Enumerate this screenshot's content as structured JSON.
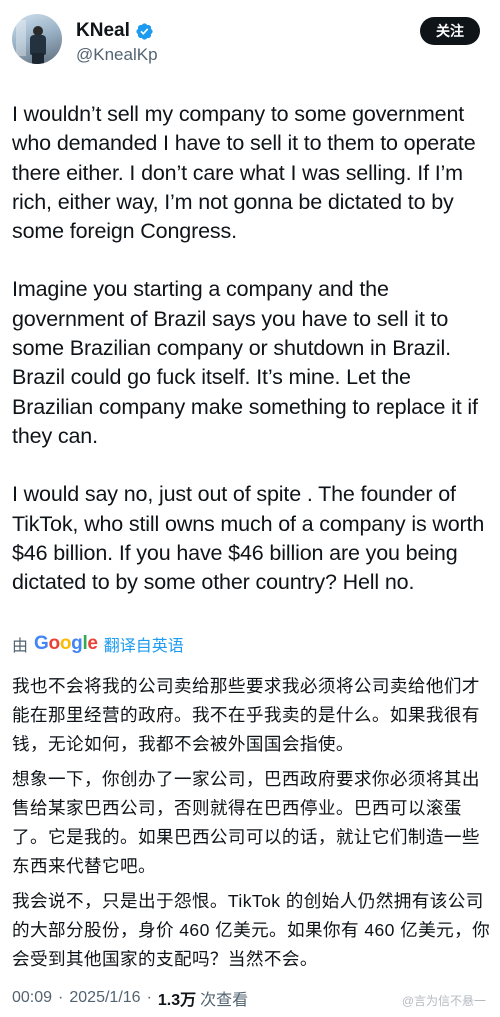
{
  "header": {
    "display_name": "KNeal",
    "handle": "@KnealKp",
    "follow_label": "关注"
  },
  "tweet": {
    "paragraphs": [
      "I wouldn’t sell my company to some government who demanded I have to sell it to them to operate there either. I don’t care what I was selling. If I’m rich, either way, I’m not gonna be dictated to by some foreign Congress.",
      "Imagine you starting a company and the government of Brazil says you have to sell it to some Brazilian company or shutdown in Brazil. Brazil could go fuck itself. It’s mine. Let the Brazilian company make something to replace it if they can.",
      "I would say no, just out of spite . The founder of TikTok, who still owns much of a company is worth $46 billion. If you have $46 billion are you being dictated to by some other country? Hell no."
    ]
  },
  "translation_bar": {
    "by_label": "由",
    "provider": "Google",
    "link_label": "翻译自英语"
  },
  "translation": {
    "paragraphs": [
      "我也不会将我的公司卖给那些要求我必须将公司卖给他们才能在那里经营的政府。我不在乎我卖的是什么。如果我很有钱，无论如何，我都不会被外国国会指使。",
      "想象一下，你创办了一家公司，巴西政府要求你必须将其出售给某家巴西公司，否则就得在巴西停业。巴西可以滚蛋了。它是我的。如果巴西公司可以的话，就让它们制造一些东西来代替它吧。",
      "我会说不，只是出于怨恨。TikTok 的创始人仍然拥有该公司的大部分股份，身价 460 亿美元。如果你有 460 亿美元，你会受到其他国家的支配吗？当然不会。"
    ]
  },
  "meta": {
    "time": "00:09",
    "separator": "·",
    "date": "2025/1/16",
    "views_count": "1.3万",
    "views_label": "次查看"
  },
  "watermark": "@言为信不悬一",
  "colors": {
    "text": "#0f1419",
    "secondary": "#536471",
    "link": "#1d9bf0",
    "verified": "#1d9bf0",
    "button_bg": "#0f1419"
  },
  "icons": {
    "verified": "verified-badge-icon",
    "avatar": "avatar"
  }
}
